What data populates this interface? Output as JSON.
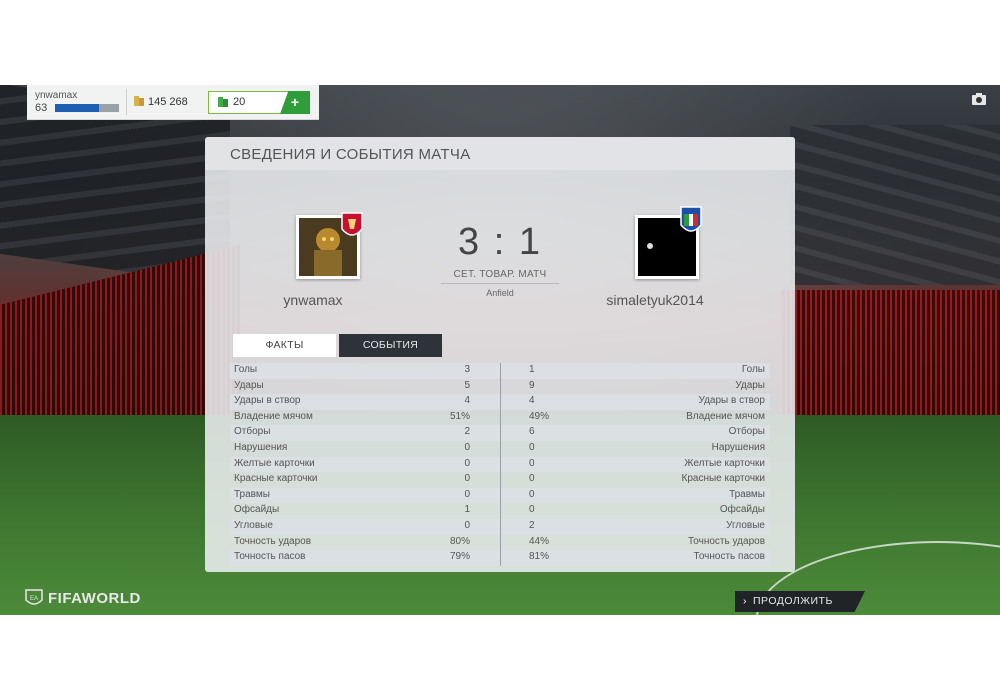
{
  "hud": {
    "username": "ynwamax",
    "level": "63",
    "xp_progress": 0.68,
    "coins": "145 268",
    "points": "20",
    "add_label": "+"
  },
  "panel": {
    "title": "СВЕДЕНИЯ И СОБЫТИЯ МАТЧА",
    "home_team": "ynwamax",
    "away_team": "simaletyuk2014",
    "score": "3 : 1",
    "match_type": "СЕТ. ТОВАР. МАТЧ",
    "stadium": "Anfield",
    "tabs": [
      "ФАКТЫ",
      "СОБЫТИЯ"
    ]
  },
  "stats": [
    {
      "label": "Голы",
      "home": "3",
      "away": "1"
    },
    {
      "label": "Удары",
      "home": "5",
      "away": "9"
    },
    {
      "label": "Удары в створ",
      "home": "4",
      "away": "4"
    },
    {
      "label": "Владение мячом",
      "home": "51%",
      "away": "49%"
    },
    {
      "label": "Отборы",
      "home": "2",
      "away": "6"
    },
    {
      "label": "Нарушения",
      "home": "0",
      "away": "0"
    },
    {
      "label": "Желтые карточки",
      "home": "0",
      "away": "0"
    },
    {
      "label": "Красные карточки",
      "home": "0",
      "away": "0"
    },
    {
      "label": "Травмы",
      "home": "0",
      "away": "0"
    },
    {
      "label": "Офсайды",
      "home": "1",
      "away": "0"
    },
    {
      "label": "Угловые",
      "home": "0",
      "away": "2"
    },
    {
      "label": "Точность ударов",
      "home": "80%",
      "away": "44%"
    },
    {
      "label": "Точность пасов",
      "home": "79%",
      "away": "81%"
    }
  ],
  "footer": {
    "logo": "FIFAWORLD",
    "continue_label": "ПРОДОЛЖИТЬ"
  },
  "colors": {
    "accent_green": "#2f9e3a",
    "xp_blue": "#1e5fb1",
    "dark_button": "#202427"
  }
}
